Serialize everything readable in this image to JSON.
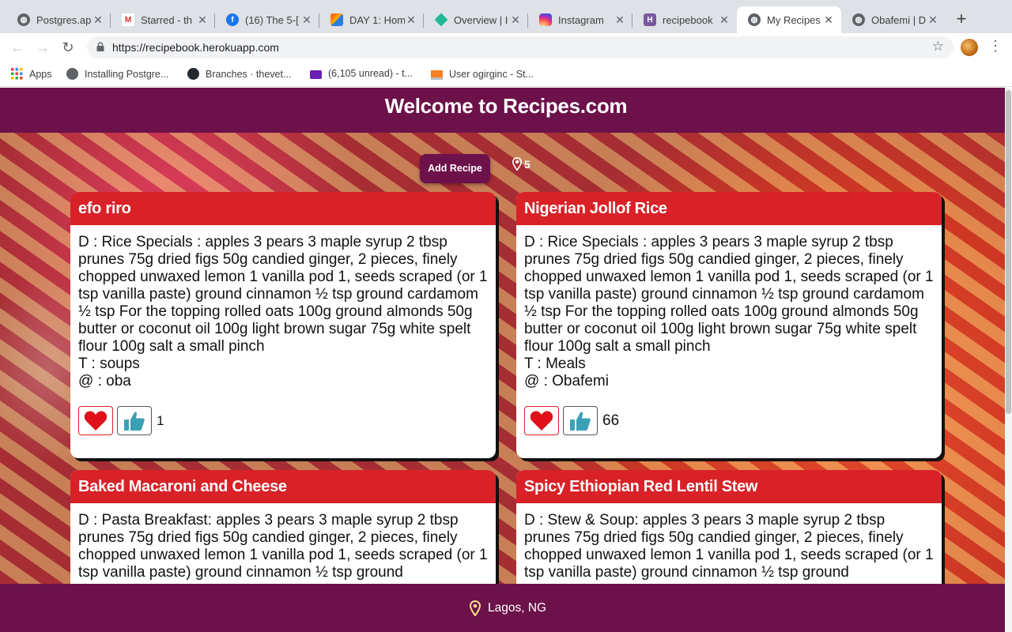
{
  "browser": {
    "tabs": [
      {
        "title": "Postgres.ap",
        "icon": "globe-icon",
        "active": false
      },
      {
        "title": "Starred - th",
        "icon": "gmail-icon",
        "active": false
      },
      {
        "title": "(16) The 5-[",
        "icon": "facebook-icon",
        "active": false
      },
      {
        "title": "DAY 1: Hom",
        "icon": "zapier-icon",
        "active": false
      },
      {
        "title": "Overview | I",
        "icon": "diamond-icon",
        "active": false
      },
      {
        "title": "Instagram",
        "icon": "instagram-icon",
        "active": false
      },
      {
        "title": "recipebook",
        "icon": "heroku-icon",
        "active": false
      },
      {
        "title": "My Recipes",
        "icon": "globe-icon",
        "active": true
      },
      {
        "title": "Obafemi | D",
        "icon": "globe-icon",
        "active": false
      }
    ],
    "url": "https://recipebook.herokuapp.com",
    "bookmarks": [
      {
        "label": "Apps",
        "icon": "apps-grid-icon"
      },
      {
        "label": "Installing Postgre...",
        "icon": "globe-icon"
      },
      {
        "label": "Branches · thevet...",
        "icon": "github-icon"
      },
      {
        "label": "(6,105 unread) - t...",
        "icon": "mail-icon"
      },
      {
        "label": "User ogirginc - St...",
        "icon": "stackoverflow-icon"
      }
    ]
  },
  "page": {
    "title": "Welcome to Recipes.com",
    "add_button": "Add Recipe",
    "recipe_count": "5",
    "footer_location": "Lagos, NG",
    "colors": {
      "brand": "#6c1149",
      "card_header": "#d82228",
      "like_icon": "#3ba0b5",
      "heart": "#e0101a"
    }
  },
  "recipes": [
    {
      "name": "efo riro",
      "description": "D : Rice Specials : apples 3 pears 3 maple syrup 2 tbsp prunes 75g dried figs 50g candied ginger, 2 pieces, finely chopped unwaxed lemon 1 vanilla pod 1, seeds scraped (or 1 tsp vanilla paste) ground cinnamon ½ tsp ground cardamom ½ tsp For the topping rolled oats 100g ground almonds 50g butter or coconut oil 100g light brown sugar 75g white spelt flour 100g salt a small pinch",
      "type": "T : soups",
      "author": "@ : oba",
      "likes": "1"
    },
    {
      "name": "Nigerian Jollof Rice",
      "description": "D : Rice Specials : apples 3 pears 3 maple syrup 2 tbsp prunes 75g dried figs 50g candied ginger, 2 pieces, finely chopped unwaxed lemon 1 vanilla pod 1, seeds scraped (or 1 tsp vanilla paste) ground cinnamon ½ tsp ground cardamom ½ tsp For the topping rolled oats 100g ground almonds 50g butter or coconut oil 100g light brown sugar 75g white spelt flour 100g salt a small pinch",
      "type": "T : Meals",
      "author": "@ : Obafemi",
      "likes": "66"
    },
    {
      "name": "Baked Macaroni and Cheese",
      "description": "D : Pasta Breakfast: apples 3 pears 3 maple syrup 2 tbsp prunes 75g dried figs 50g candied ginger, 2 pieces, finely chopped unwaxed lemon 1 vanilla pod 1, seeds scraped (or 1 tsp vanilla paste) ground cinnamon ½ tsp ground",
      "type": "",
      "author": "",
      "likes": ""
    },
    {
      "name": "Spicy Ethiopian Red Lentil Stew",
      "description": "D : Stew & Soup: apples 3 pears 3 maple syrup 2 tbsp prunes 75g dried figs 50g candied ginger, 2 pieces, finely chopped unwaxed lemon 1 vanilla pod 1, seeds scraped (or 1 tsp vanilla paste) ground cinnamon ½ tsp ground",
      "type": "",
      "author": "",
      "likes": ""
    }
  ]
}
